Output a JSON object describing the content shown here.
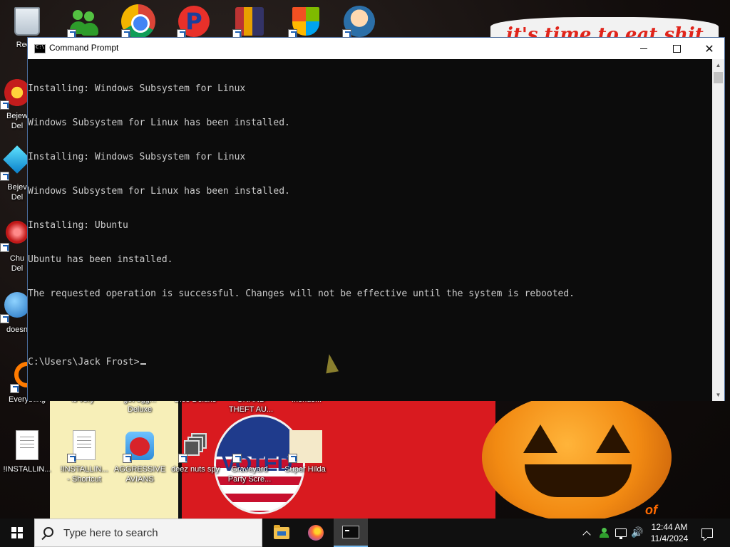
{
  "wallpaper": {
    "banner_text": "it's time to eat shit",
    "vote_text": "VOTED",
    "corner_text": "of"
  },
  "desktop_icons": {
    "recycle_bin": "Recyc",
    "bejeweled_1": "Bejew\nDel",
    "bejeweled_2": "Bejev\nDel",
    "chuzzle": "Chu\nDel",
    "doesn": "doesn",
    "everything": "Everything",
    "is_very": "is very",
    "get_egg": "get egg...\nDeluxe",
    "dice_deluxe": "Dice Deluxe",
    "grand_theft": "GRAND\nTHEFT AU...",
    "friends": "friends...",
    "installing_txt": "!INSTALLIN...",
    "installing_shortcut": "!INSTALLIN...\n- Shortcut",
    "aggressive_avians": "AGGRESSIVE\nAVIANS",
    "deez_nuts": "deez nuts spy",
    "graveyard": "Graveyard\nParty Scre...",
    "super_hilda": "Super Hilda"
  },
  "window": {
    "title": "Command Prompt",
    "console_lines": [
      "Installing: Windows Subsystem for Linux",
      "Windows Subsystem for Linux has been installed.",
      "Installing: Windows Subsystem for Linux",
      "Windows Subsystem for Linux has been installed.",
      "Installing: Ubuntu",
      "Ubuntu has been installed.",
      "The requested operation is successful. Changes will not be effective until the system is rebooted.",
      "",
      "C:\\Users\\Jack Frost>"
    ],
    "close_glyph": "✕"
  },
  "taskbar": {
    "search_placeholder": "Type here to search",
    "volume_glyph": "🔊",
    "time": "12:44 AM",
    "date": "11/4/2024"
  },
  "colors": {
    "console_bg": "#0c0c0c",
    "console_text": "#cccccc",
    "taskbar_bg": "#101010",
    "active_accent": "#76b9ed"
  }
}
